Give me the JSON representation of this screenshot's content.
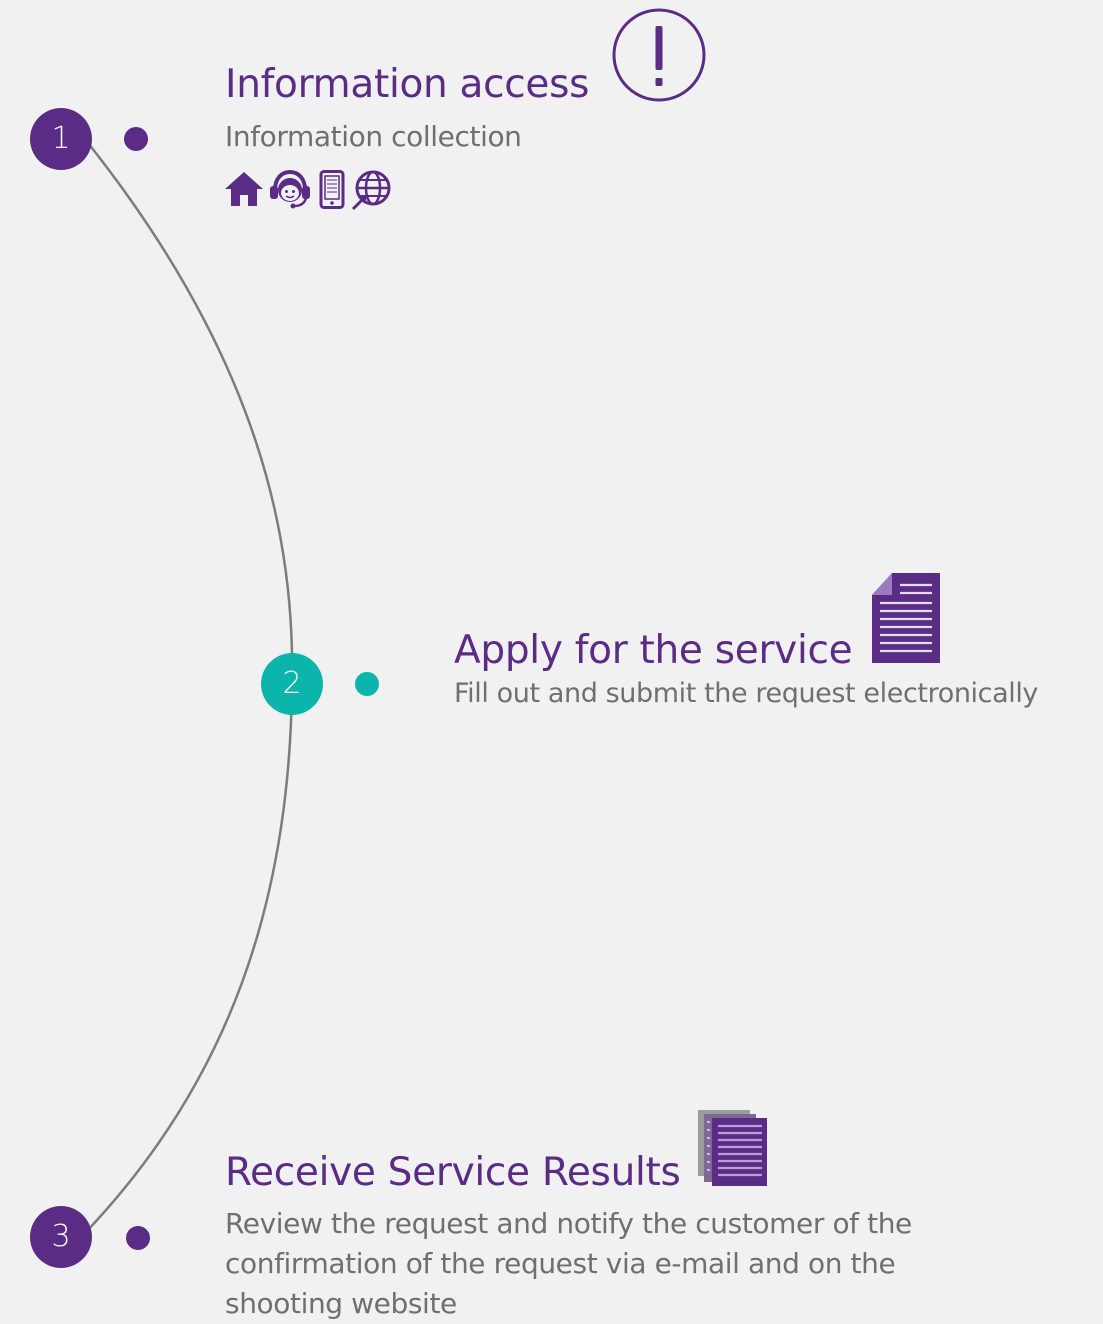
{
  "colors": {
    "purple": "#5b2c86",
    "teal": "#0bb5ac",
    "gray_text": "#6f6f6f",
    "line": "#7c7c7c",
    "background": "#f1f1f1"
  },
  "steps": [
    {
      "number": "1",
      "title": "Information access",
      "description": "Information collection",
      "accent": "#5b2c86",
      "icons": [
        "exclamation-circle-icon",
        "home-icon",
        "headset-support-icon",
        "mobile-phone-icon",
        "globe-cursor-icon"
      ]
    },
    {
      "number": "2",
      "title": "Apply for the service",
      "description": "Fill out and submit the request electronically",
      "accent": "#0bb5ac",
      "icons": [
        "document-icon"
      ]
    },
    {
      "number": "3",
      "title": "Receive Service Results",
      "description": "Review the request and notify the customer of the confirmation of the request via e-mail and on the shooting website",
      "accent": "#5b2c86",
      "icons": [
        "stacked-documents-icon"
      ]
    }
  ]
}
